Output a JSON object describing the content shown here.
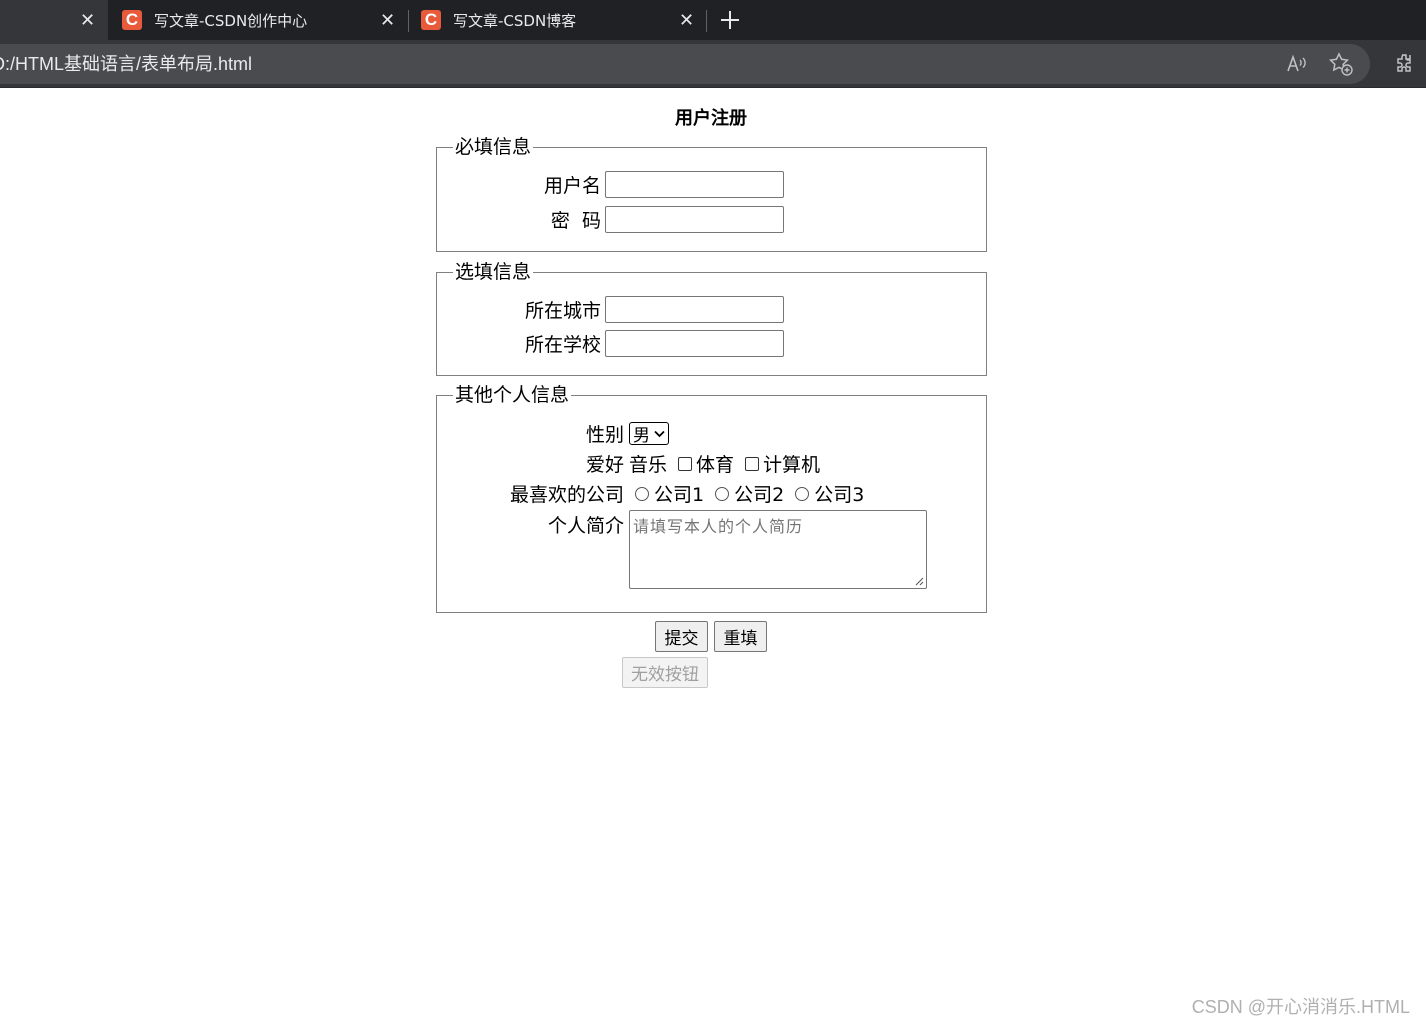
{
  "browser": {
    "tabs": [
      {
        "title": "",
        "active": true
      },
      {
        "title": "写文章-CSDN创作中心",
        "favicon": "C",
        "active": false
      },
      {
        "title": "写文章-CSDN博客",
        "favicon": "C",
        "active": false
      }
    ],
    "new_tab_icon": "plus-icon",
    "url": "D:/HTML基础语言/表单布局.html",
    "toolbar_icons": [
      "read-aloud-icon",
      "add-favorite-icon",
      "extensions-icon"
    ]
  },
  "form": {
    "title": "用户注册",
    "required_section": {
      "legend": "必填信息",
      "username_label": "用户名",
      "username_value": "",
      "password_label": "密  码",
      "password_value": ""
    },
    "optional_section": {
      "legend": "选填信息",
      "city_label": "所在城市",
      "city_value": "",
      "school_label": "所在学校",
      "school_value": ""
    },
    "other_section": {
      "legend": "其他个人信息",
      "gender_label": "性别",
      "gender_selected": "男",
      "hobby_label": "爱好",
      "hobbies": [
        "音乐",
        "体育",
        "计算机"
      ],
      "company_label": "最喜欢的公司",
      "companies": [
        "公司1",
        "公司2",
        "公司3"
      ],
      "intro_label": "个人简介",
      "intro_placeholder": "请填写本人的个人简历"
    },
    "submit_label": "提交",
    "reset_label": "重填",
    "disabled_label": "无效按钮"
  },
  "watermark": "CSDN @开心消消乐.HTML"
}
